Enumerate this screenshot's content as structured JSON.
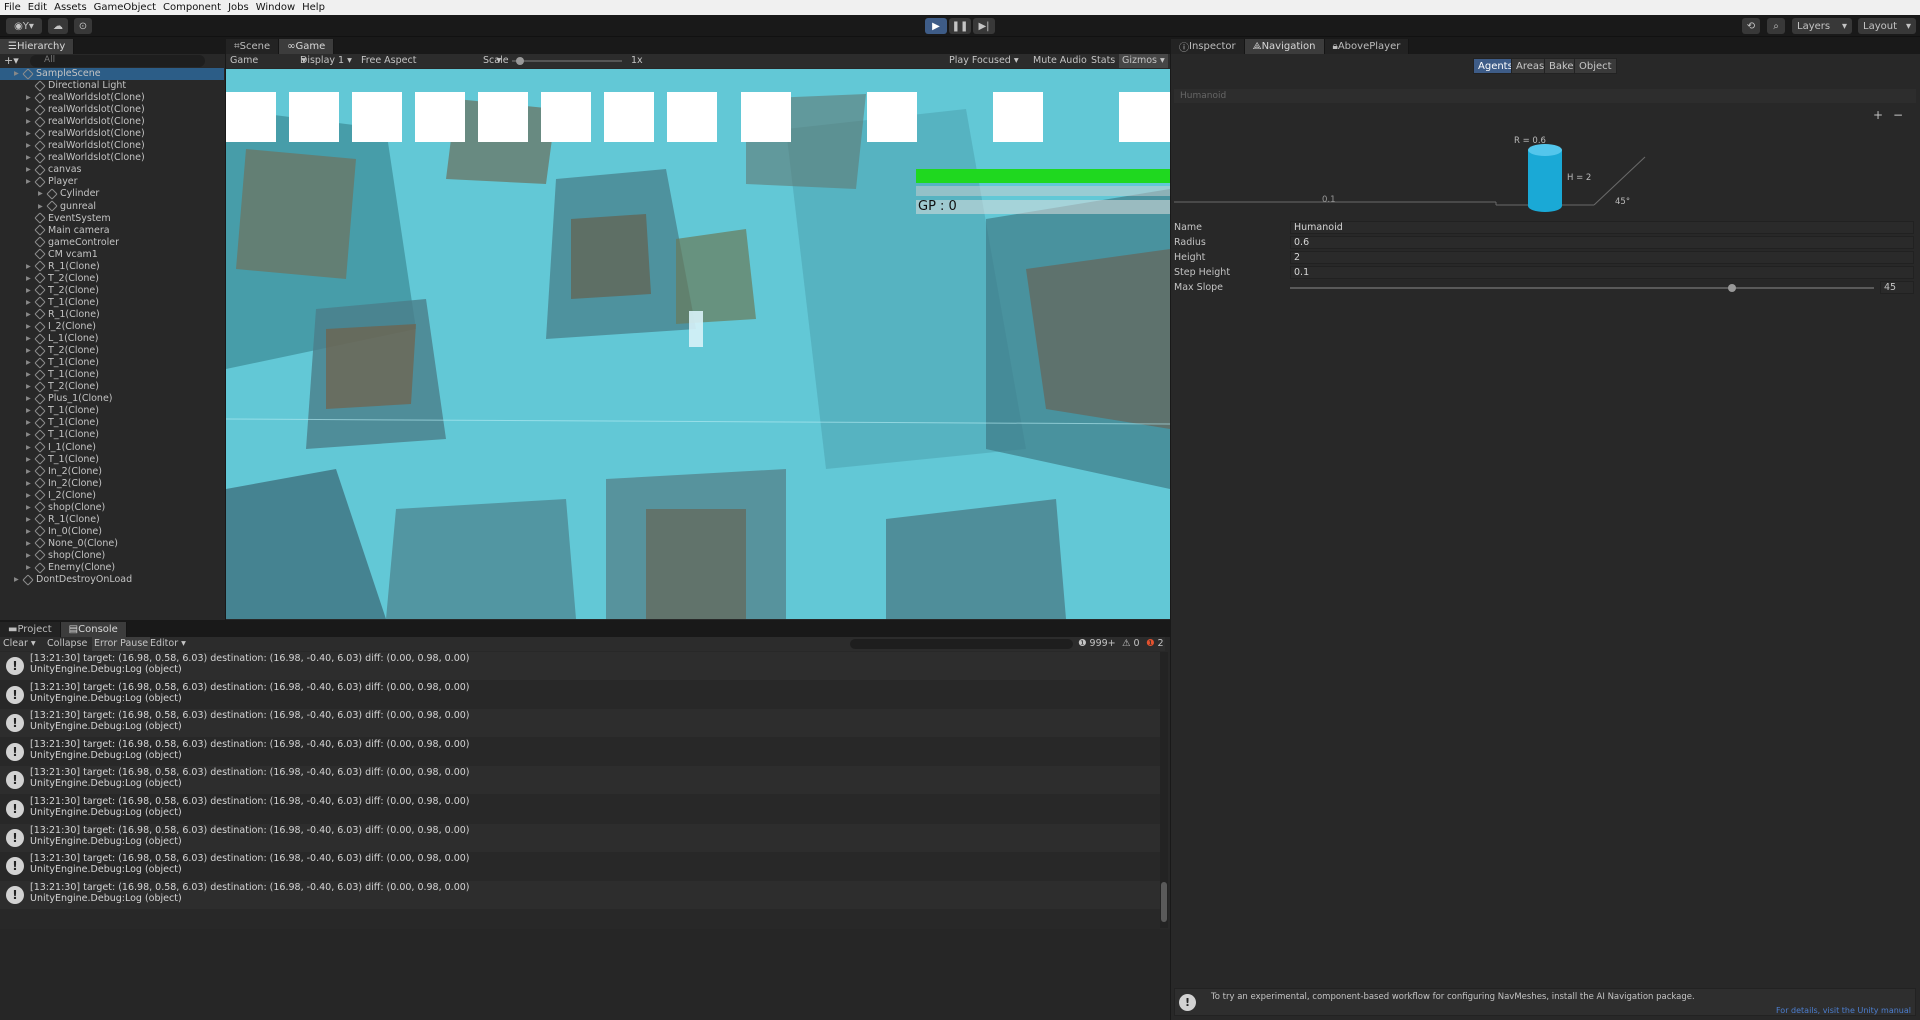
{
  "menu": [
    "File",
    "Edit",
    "Assets",
    "GameObject",
    "Component",
    "Jobs",
    "Window",
    "Help"
  ],
  "toolbar": {
    "account": "Y",
    "layers": "Layers",
    "layout": "Layout"
  },
  "hierarchy": {
    "tab": "Hierarchy",
    "search_placeholder": "All",
    "scene": "SampleScene",
    "items": [
      "Directional Light",
      "realWorldslot(Clone)",
      "realWorldslot(Clone)",
      "realWorldslot(Clone)",
      "realWorldslot(Clone)",
      "realWorldslot(Clone)",
      "realWorldslot(Clone)",
      "canvas",
      "Player",
      "Cylinder",
      "gunreal",
      "EventSystem",
      "Main camera",
      "gameControler",
      "CM vcam1",
      "R_1(Clone)",
      "T_2(Clone)",
      "T_2(Clone)",
      "T_1(Clone)",
      "R_1(Clone)",
      "I_2(Clone)",
      "L_1(Clone)",
      "T_2(Clone)",
      "T_1(Clone)",
      "T_1(Clone)",
      "T_2(Clone)",
      "Plus_1(Clone)",
      "T_1(Clone)",
      "T_1(Clone)",
      "T_1(Clone)",
      "I_1(Clone)",
      "T_1(Clone)",
      "In_2(Clone)",
      "In_2(Clone)",
      "I_2(Clone)",
      "shop(Clone)",
      "R_1(Clone)",
      "In_0(Clone)",
      "None_0(Clone)",
      "shop(Clone)",
      "Enemy(Clone)"
    ],
    "dont_destroy": "DontDestroyOnLoad"
  },
  "game": {
    "tabs": [
      "Scene",
      "Game"
    ],
    "mode": "Game",
    "display": "Display 1",
    "aspect": "Free Aspect",
    "scale_label": "Scale",
    "scale_value": "1x",
    "play_focused": "Play Focused",
    "mute": "Mute Audio",
    "stats": "Stats",
    "gizmos": "Gizmos",
    "gp": "GP : 0",
    "health_pct": 100
  },
  "inspector": {
    "tabs": [
      "Inspector",
      "Navigation",
      "AbovePlayer"
    ],
    "nav_tabs": [
      "Agents",
      "Areas",
      "Bake",
      "Object"
    ],
    "agent_header": "Humanoid",
    "diagram": {
      "radius": "R = 0.6",
      "height": "H = 2",
      "step": "0.1",
      "slope": "45°"
    },
    "fields": [
      {
        "label": "Name",
        "value": "Humanoid"
      },
      {
        "label": "Radius",
        "value": "0.6"
      },
      {
        "label": "Height",
        "value": "2"
      },
      {
        "label": "Step Height",
        "value": "0.1"
      },
      {
        "label": "Max Slope",
        "value": "45"
      }
    ],
    "max_slope_pct": 0.75,
    "info": "To try an experimental, component-based workflow for configuring NavMeshes, install the AI Navigation package.",
    "link": "For details, visit the Unity manual"
  },
  "console": {
    "tabs": [
      "Project",
      "Console"
    ],
    "clear": "Clear",
    "collapse": "Collapse",
    "error_pause": "Error Pause",
    "editor": "Editor",
    "counts": {
      "log": "999+",
      "warn": "0",
      "error": "2"
    },
    "line1": "[13:21:30] target: (16.98, 0.58, 6.03) destination: (16.98, -0.40, 6.03) diff: (0.00, 0.98, 0.00)",
    "line2": "UnityEngine.Debug:Log (object)",
    "rows": 9
  },
  "colors": {
    "accent": "#3e5c87",
    "sky": "#5fc9d8",
    "health": "#1fd81f"
  }
}
